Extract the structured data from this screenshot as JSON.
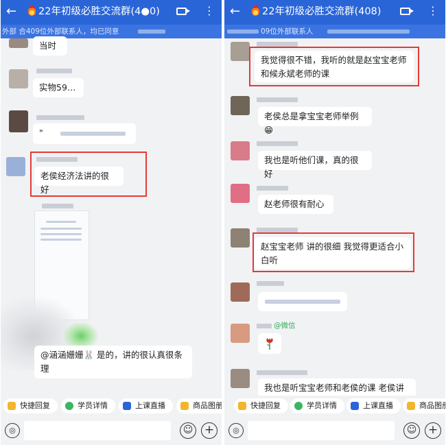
{
  "left": {
    "header": {
      "back": "←",
      "title": "22年初级必胜交流群(4●0)",
      "menu": "⋮"
    },
    "subbar": {
      "text": "外部 合409位外部联系人，均已同意"
    },
    "messages": [
      {
        "text": "当时"
      },
      {
        "text": "实物59…"
      },
      {
        "text": "\""
      },
      {
        "text": "老侯经济法讲的很好"
      },
      {
        "text": "@涵涵姗姗🐰 是的，讲的很认真很条理"
      }
    ],
    "quick_replies": [
      "快捷回复",
      "学员详情",
      "上课直播",
      "商品图册"
    ],
    "input": {
      "voice": "◎",
      "emoji": "☺",
      "plus": "+"
    }
  },
  "right": {
    "header": {
      "back": "←",
      "title": "22年初级必胜交流群(408)",
      "menu": "⋮"
    },
    "subbar": {
      "text": "09位外部联系人"
    },
    "messages": [
      {
        "text": "我觉得很不错，我听的就是赵宝宝老师和候永斌老师的课"
      },
      {
        "text": "老侯总是拿宝宝老师举例😁"
      },
      {
        "text": "也是听他们课，真的很好",
        "prefix": "我"
      },
      {
        "text": "赵老师很有耐心"
      },
      {
        "text": "赵宝宝老师 讲的很细 我觉得更适合小白听"
      },
      {
        "text": "@微信"
      },
      {
        "text": "我也是听宝宝老师和老侯的课 老侯讲"
      }
    ],
    "quick_replies": [
      "快捷回复",
      "学员详情",
      "上课直播",
      "商品图册"
    ],
    "input": {
      "voice": "◎",
      "emoji": "☺",
      "plus": "+"
    }
  },
  "colors": {
    "header": "#2a65d8",
    "subbar": "#3b74e0",
    "highlight": "#e53935",
    "background": "#f1f2f4"
  }
}
